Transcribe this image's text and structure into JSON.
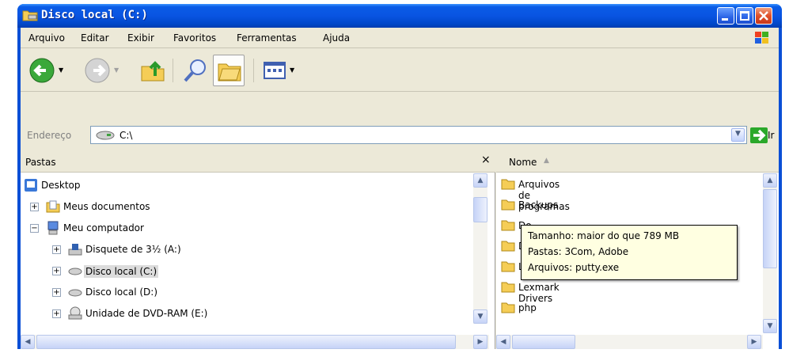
{
  "window": {
    "title": "Disco local (C:)"
  },
  "menu": [
    "Arquivo",
    "Editar",
    "Exibir",
    "Favoritos",
    "Ferramentas",
    "Ajuda"
  ],
  "address": {
    "label": "Endereço",
    "value": "C:\\",
    "go_label": "Ir"
  },
  "folders_pane": {
    "title": "Pastas",
    "close_glyph": "×",
    "tree": [
      {
        "label": "Desktop"
      },
      {
        "label": "Meus documentos",
        "toggle": "+"
      },
      {
        "label": "Meu computador",
        "toggle": "−"
      },
      {
        "label": "Disquete de 3½ (A:)",
        "toggle": "+"
      },
      {
        "label": "Disco local (C:)",
        "toggle": "+",
        "selected": true
      },
      {
        "label": "Disco local (D:)",
        "toggle": "+"
      },
      {
        "label": "Unidade de DVD-RAM (E:)",
        "toggle": "+"
      }
    ]
  },
  "file_list": {
    "column_header": "Nome",
    "items": [
      "Arquivos de programas",
      "Backups",
      "Do",
      "Do",
      "Le",
      "Lexmark Drivers",
      "php"
    ]
  },
  "tooltip": {
    "size": "Tamanho: maior do que 789 MB",
    "folders": "Pastas: 3Com, Adobe",
    "files": "Arquivos: putty.exe"
  },
  "colors": {
    "titlebar": "#0054e3",
    "folder": "#f5cd56",
    "selection": "#dcdcdc",
    "tooltip_bg": "#ffffe1"
  }
}
